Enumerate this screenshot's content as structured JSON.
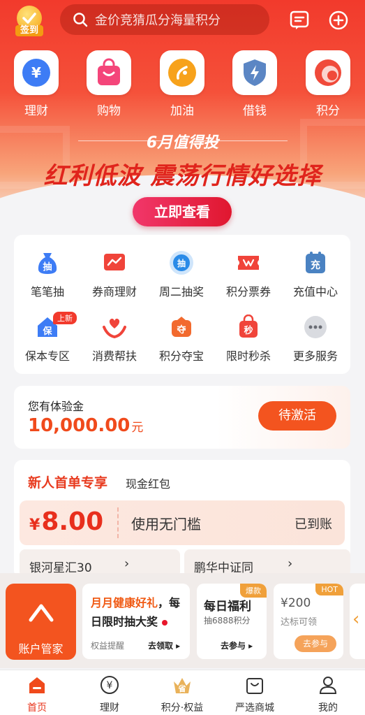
{
  "header": {
    "checkin_label": "签到",
    "search_placeholder": "金价竞猜瓜分海量积分"
  },
  "quick_actions": [
    {
      "label": "理财",
      "icon": "yen-circle-icon"
    },
    {
      "label": "购物",
      "icon": "shopping-bag-icon"
    },
    {
      "label": "加油",
      "icon": "fuel-drop-icon"
    },
    {
      "label": "借钱",
      "icon": "lightning-shield-icon"
    },
    {
      "label": "积分",
      "icon": "points-swirl-icon"
    }
  ],
  "banner": {
    "subtitle": "6月值得投",
    "title": "红利低波 震荡行情好选择",
    "button_label": "立即查看"
  },
  "services": [
    {
      "label": "笔笔抽",
      "icon": "money-bag-icon",
      "glyph": "抽"
    },
    {
      "label": "券商理财",
      "icon": "chart-icon",
      "glyph": ""
    },
    {
      "label": "周二抽奖",
      "icon": "lottery-icon",
      "glyph": "抽"
    },
    {
      "label": "积分票券",
      "icon": "ticket-icon",
      "glyph": ""
    },
    {
      "label": "充值中心",
      "icon": "recharge-icon",
      "glyph": "充"
    },
    {
      "label": "保本专区",
      "icon": "guarantee-house-icon",
      "glyph": "保",
      "badge": "上新"
    },
    {
      "label": "消费帮扶",
      "icon": "helping-hands-icon",
      "glyph": ""
    },
    {
      "label": "积分夺宝",
      "icon": "treasure-icon",
      "glyph": "夺"
    },
    {
      "label": "限时秒杀",
      "icon": "flash-sale-bag-icon",
      "glyph": "秒"
    },
    {
      "label": "更多服务",
      "icon": "more-dots-icon",
      "glyph": ""
    }
  ],
  "experience": {
    "title": "您有体验金",
    "amount": "10,000.00",
    "unit": "元",
    "button_label": "待激活"
  },
  "new_user": {
    "title": "新人首单专享",
    "subtitle": "现金红包",
    "coupon": {
      "currency": "¥",
      "amount": "8.00",
      "desc": "使用无门槛",
      "status": "已到账"
    },
    "cards": [
      {
        "label": "银河星汇30"
      },
      {
        "label": "鹏华中证同"
      }
    ]
  },
  "float_bar": {
    "account_label": "账户管家",
    "promo": {
      "title_highlight": "月月健康好礼",
      "title_rest": "，每日限时抽大奖",
      "tag": "权益提醒",
      "action": "去领取 ▸"
    },
    "welfare": {
      "title": "每日福利",
      "desc": "抽6888积分",
      "action": "去参与 ▸",
      "badge": "爆款"
    },
    "reward": {
      "amount": "¥200",
      "desc": "达标可领",
      "action": "去参与",
      "badge": "HOT"
    },
    "expand_icon": "‹"
  },
  "tabs": [
    {
      "label": "首页",
      "icon": "home-icon",
      "active": true
    },
    {
      "label": "理财",
      "icon": "yen-icon",
      "active": false
    },
    {
      "label": "积分·权益",
      "icon": "crown-points-icon",
      "glyph": "省",
      "active": false
    },
    {
      "label": "严选商城",
      "icon": "shopping-bag-outline-icon",
      "active": false
    },
    {
      "label": "我的",
      "icon": "user-icon",
      "active": false
    }
  ],
  "colors": {
    "brand_red": "#f23a2c",
    "accent_orange": "#f3541f",
    "coupon_red": "#e82f1d"
  }
}
